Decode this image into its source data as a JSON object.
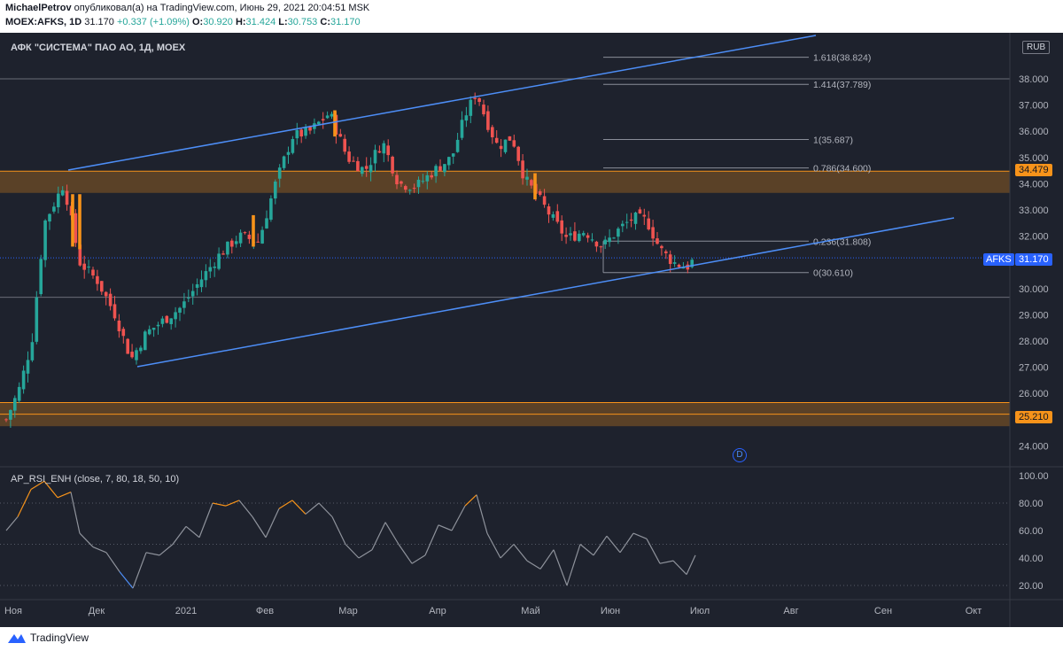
{
  "header": {
    "author": "MichaelPetrov",
    "published_text": "опубликовал(а) на TradingView.com, Июнь 29, 2021 20:04:51 MSK",
    "symbol": "MOEX:AFKS, 1D",
    "last": "31.170",
    "change": "+0.337 (+1.09%)",
    "o_label": "O:",
    "o_value": "30.920",
    "h_label": "H:",
    "h_value": "31.424",
    "l_label": "L:",
    "l_value": "30.753",
    "c_label": "C:",
    "c_value": "31.170"
  },
  "chart": {
    "legend_title": "АФК \"СИСТЕМА\" ПАО АО, 1Д, MOEX",
    "currency": "RUB",
    "symbol_badge": "AFKS",
    "last_price_badge": "31.170",
    "resistance_badge": "34.479",
    "support_badge": "25.210",
    "event_marker": "D",
    "price_axis": [
      "38.000",
      "37.000",
      "36.000",
      "35.000",
      "34.000",
      "33.000",
      "32.000",
      "31.000",
      "30.000",
      "29.000",
      "28.000",
      "27.000",
      "26.000",
      "25.000",
      "24.000"
    ],
    "fib_levels": [
      {
        "label": "1.618(38.824)",
        "price": 38.824
      },
      {
        "label": "1.414(37.789)",
        "price": 37.789
      },
      {
        "label": "1(35.687)",
        "price": 35.687
      },
      {
        "label": "0.786(34.600)",
        "price": 34.6
      },
      {
        "label": "0.236(31.808)",
        "price": 31.808
      },
      {
        "label": "0(30.610)",
        "price": 30.61
      }
    ],
    "zones": [
      {
        "name": "resistance-zone",
        "top": 34.479,
        "bottom": 33.65,
        "color": "#f7931a"
      },
      {
        "name": "support-zone",
        "top": 25.65,
        "bottom": 24.75,
        "color": "#f7931a"
      }
    ],
    "x_axis": [
      "Ноя",
      "Дек",
      "2021",
      "Фев",
      "Мар",
      "Апр",
      "Май",
      "Июн",
      "Июл",
      "Авг",
      "Сен",
      "Окт"
    ],
    "colors": {
      "background": "#1e222d",
      "up": "#26a69a",
      "down": "#ef5350",
      "channel": "#4d8ef7",
      "fib": "#8a8e99",
      "zone": "#f7931a",
      "rsi": "#8f939c",
      "rsi_high": "#f7931a",
      "rsi_low": "#4d8ef7"
    }
  },
  "rsi": {
    "title": "AP_RSI_ENH (close, 7, 80, 18, 50, 10)",
    "axis": [
      "100.00",
      "80.00",
      "60.00",
      "40.00",
      "20.00"
    ]
  },
  "footer": {
    "brand": "TradingView"
  }
}
